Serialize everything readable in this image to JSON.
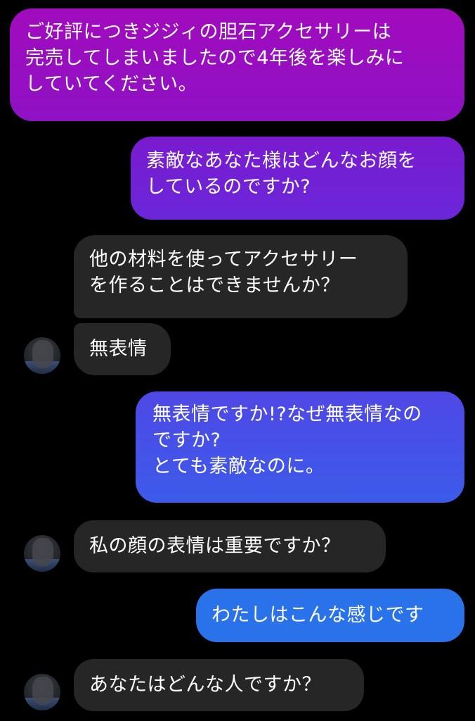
{
  "messages": [
    {
      "side": "sent",
      "text": "ご好評につきジジィの胆石アクセサリーは\n完売してしまいましたので4年後を楽しみに\nしていてください。"
    },
    {
      "side": "sent",
      "text": "素敵なあなた様はどんなお顔を\nしているのですか?"
    },
    {
      "side": "received",
      "text": "他の材料を使ってアクセサリー\nを作ることはできませんか？"
    },
    {
      "side": "received",
      "text": "無表情"
    },
    {
      "side": "sent",
      "text": "無表情ですか!?なぜ無表情なの\nですか?\nとても素敵なのに。"
    },
    {
      "side": "received",
      "text": "私の顔の表情は重要ですか？"
    },
    {
      "side": "sent",
      "text": "わたしはこんな感じです"
    },
    {
      "side": "received",
      "text": "あなたはどんな人ですか？"
    }
  ],
  "colors": {
    "background": "#000000",
    "received_bubble": "#262626",
    "sent_gradient_top": "#a10bbd",
    "sent_gradient_bottom": "#2a72ea"
  }
}
